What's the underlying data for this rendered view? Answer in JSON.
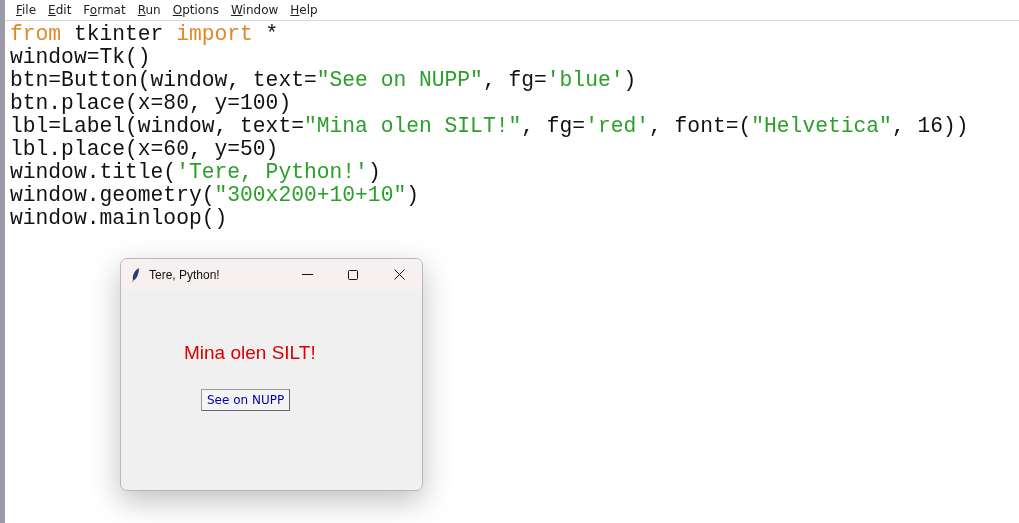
{
  "menu": [
    {
      "key": "F",
      "after": "ile"
    },
    {
      "key": "E",
      "after": "dit"
    },
    {
      "before": "F",
      "key": "o",
      "after": "rmat"
    },
    {
      "key": "R",
      "after": "un"
    },
    {
      "key": "O",
      "after": "ptions"
    },
    {
      "key": "W",
      "after": "indow"
    },
    {
      "key": "H",
      "after": "elp"
    }
  ],
  "code": [
    [
      {
        "kind": "keyword",
        "text": "from"
      },
      {
        "kind": "plain",
        "text": " tkinter "
      },
      {
        "kind": "keyword",
        "text": "import"
      },
      {
        "kind": "plain",
        "text": " *"
      }
    ],
    [
      {
        "kind": "plain",
        "text": "window=Tk()"
      }
    ],
    [
      {
        "kind": "plain",
        "text": "btn=Button(window, text="
      },
      {
        "kind": "string",
        "text": "\"See on NUPP\""
      },
      {
        "kind": "plain",
        "text": ", fg="
      },
      {
        "kind": "string",
        "text": "'blue'"
      },
      {
        "kind": "plain",
        "text": ")"
      }
    ],
    [
      {
        "kind": "plain",
        "text": "btn.place(x=80, y=100)"
      }
    ],
    [
      {
        "kind": "plain",
        "text": "lbl=Label(window, text="
      },
      {
        "kind": "string",
        "text": "\"Mina olen SILT!\""
      },
      {
        "kind": "plain",
        "text": ", fg="
      },
      {
        "kind": "string",
        "text": "'red'"
      },
      {
        "kind": "plain",
        "text": ", font=("
      },
      {
        "kind": "string",
        "text": "\"Helvetica\""
      },
      {
        "kind": "plain",
        "text": ", 16))"
      }
    ],
    [
      {
        "kind": "plain",
        "text": "lbl.place(x=60, y=50)"
      }
    ],
    [
      {
        "kind": "plain",
        "text": "window.title("
      },
      {
        "kind": "string",
        "text": "'Tere, Python!'"
      },
      {
        "kind": "plain",
        "text": ")"
      }
    ],
    [
      {
        "kind": "plain",
        "text": "window.geometry("
      },
      {
        "kind": "string",
        "text": "\"300x200+10+10\""
      },
      {
        "kind": "plain",
        "text": ")"
      }
    ],
    [
      {
        "kind": "plain",
        "text": "window.mainloop()"
      }
    ]
  ],
  "tk_window": {
    "title": "Tere, Python!",
    "label": "Mina olen SILT!",
    "button": "See on NUPP"
  }
}
